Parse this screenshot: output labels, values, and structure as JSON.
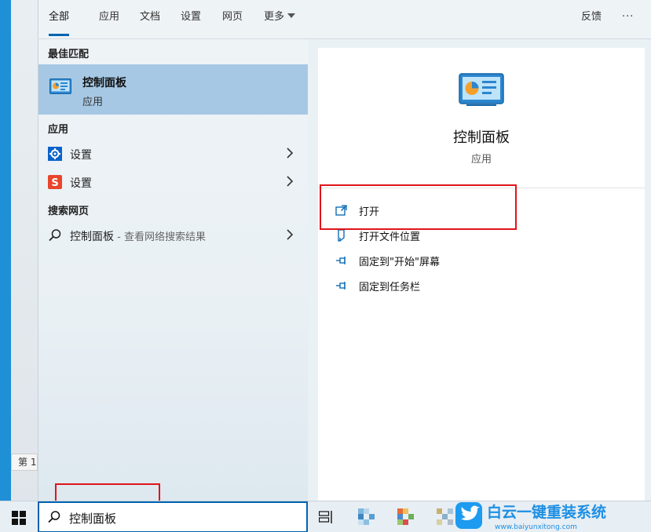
{
  "tabs": [
    {
      "label": "全部"
    },
    {
      "label": "应用"
    },
    {
      "label": "文档"
    },
    {
      "label": "设置"
    },
    {
      "label": "网页"
    },
    {
      "label": "更多"
    }
  ],
  "header_right": {
    "feedback": "反馈",
    "more": "···"
  },
  "results": {
    "best_match_title": "最佳匹配",
    "best_match": {
      "name": "控制面板",
      "kind": "应用"
    },
    "apps_title": "应用",
    "apps": [
      {
        "label": "设置",
        "icon": "gear-icon"
      },
      {
        "label": "设置",
        "icon": "s-logo-icon"
      }
    ],
    "web_title": "搜索网页",
    "web": {
      "query": "控制面板",
      "suffix": " - 查看网络搜索结果"
    }
  },
  "preview": {
    "name": "控制面板",
    "kind": "应用",
    "actions": [
      {
        "label": "打开",
        "icon": "open-icon"
      },
      {
        "label": "打开文件位置",
        "icon": "file-location-icon"
      },
      {
        "label": "固定到\"开始\"屏幕",
        "icon": "pin-icon"
      },
      {
        "label": "固定到任务栏",
        "icon": "pin-icon"
      }
    ]
  },
  "background": {
    "page_label": "第 1"
  },
  "taskbar": {
    "search_value": "控制面板"
  },
  "watermark": {
    "brand": "白云一键重装系统",
    "url": "www.baiyunxitong.com"
  },
  "colors": {
    "accent": "#0063b1",
    "selection": "#a6c8e4",
    "highlight_box": "#e0141a"
  }
}
